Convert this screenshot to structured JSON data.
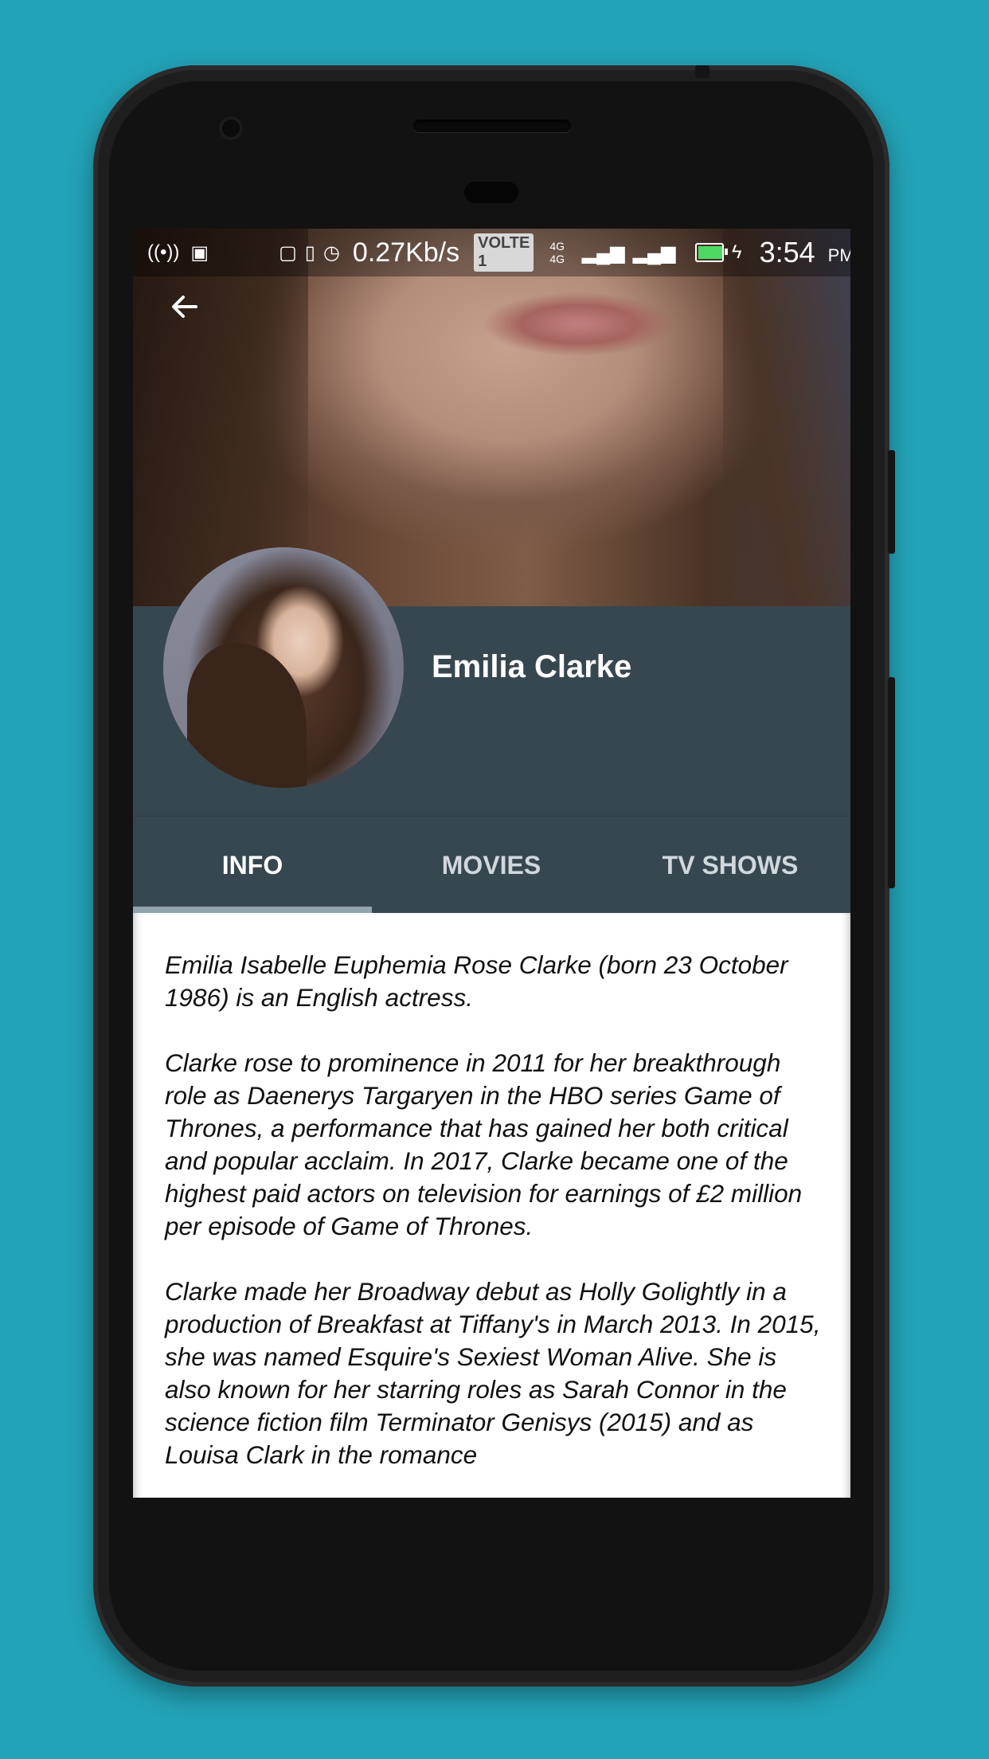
{
  "statusbar": {
    "speed": "0.27Kb/s",
    "volte": "VOLTE 1",
    "net1": "4G 4G",
    "time": "3:54",
    "ampm": "PM",
    "battery_level": 0.75
  },
  "profile": {
    "name": "Emilia Clarke"
  },
  "tabs": [
    {
      "label": "INFO"
    },
    {
      "label": "MOVIES"
    },
    {
      "label": "TV SHOWS"
    }
  ],
  "bio": {
    "paragraphs": [
      "Emilia Isabelle Euphemia Rose Clarke (born 23 October 1986) is an English actress.",
      "Clarke rose to prominence in 2011 for her breakthrough role as Daenerys Targaryen in the HBO series Game of Thrones, a performance that has gained her both critical and popular acclaim. In 2017, Clarke became one of the highest paid actors on television for earnings of £2 million per episode of Game of Thrones.",
      "Clarke made her Broadway debut as Holly Golightly in a production of Breakfast at Tiffany's in March 2013. In 2015, she was named Esquire's Sexiest Woman Alive. She is also known for her starring roles as Sarah Connor in the science fiction film Terminator Genisys (2015) and as Louisa Clark in the romance"
    ]
  }
}
